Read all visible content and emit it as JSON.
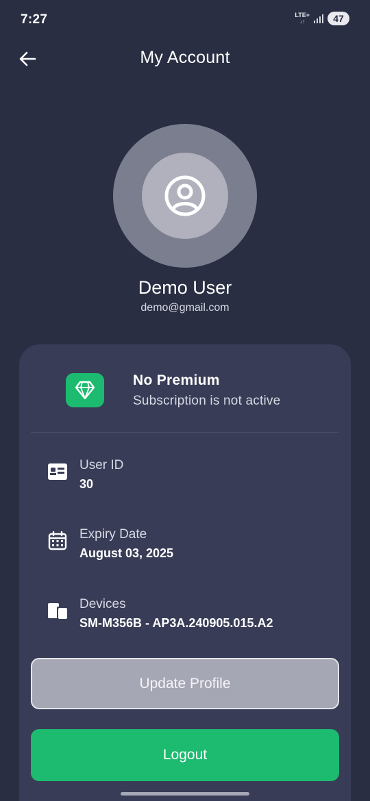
{
  "status_bar": {
    "time": "7:27",
    "network": "LTE+",
    "battery": "47"
  },
  "header": {
    "title": "My Account",
    "back_icon": "arrow-left-icon"
  },
  "profile": {
    "avatar_icon": "user-circle-icon",
    "name": "Demo User",
    "email": "demo@gmail.com"
  },
  "subscription": {
    "icon": "diamond-icon",
    "title": "No Premium",
    "subtitle": "Subscription is not active"
  },
  "details": [
    {
      "icon": "id-card-icon",
      "label": "User ID",
      "value": "30"
    },
    {
      "icon": "calendar-icon",
      "label": "Expiry Date",
      "value": "August 03, 2025"
    },
    {
      "icon": "devices-icon",
      "label": "Devices",
      "value": "SM-M356B - AP3A.240905.015.A2"
    }
  ],
  "buttons": {
    "update_label": "Update Profile",
    "logout_label": "Logout"
  },
  "colors": {
    "background": "#292e42",
    "card": "#383c56",
    "accent_green": "#1cbb6f",
    "update_button": "#a6a7b4"
  }
}
